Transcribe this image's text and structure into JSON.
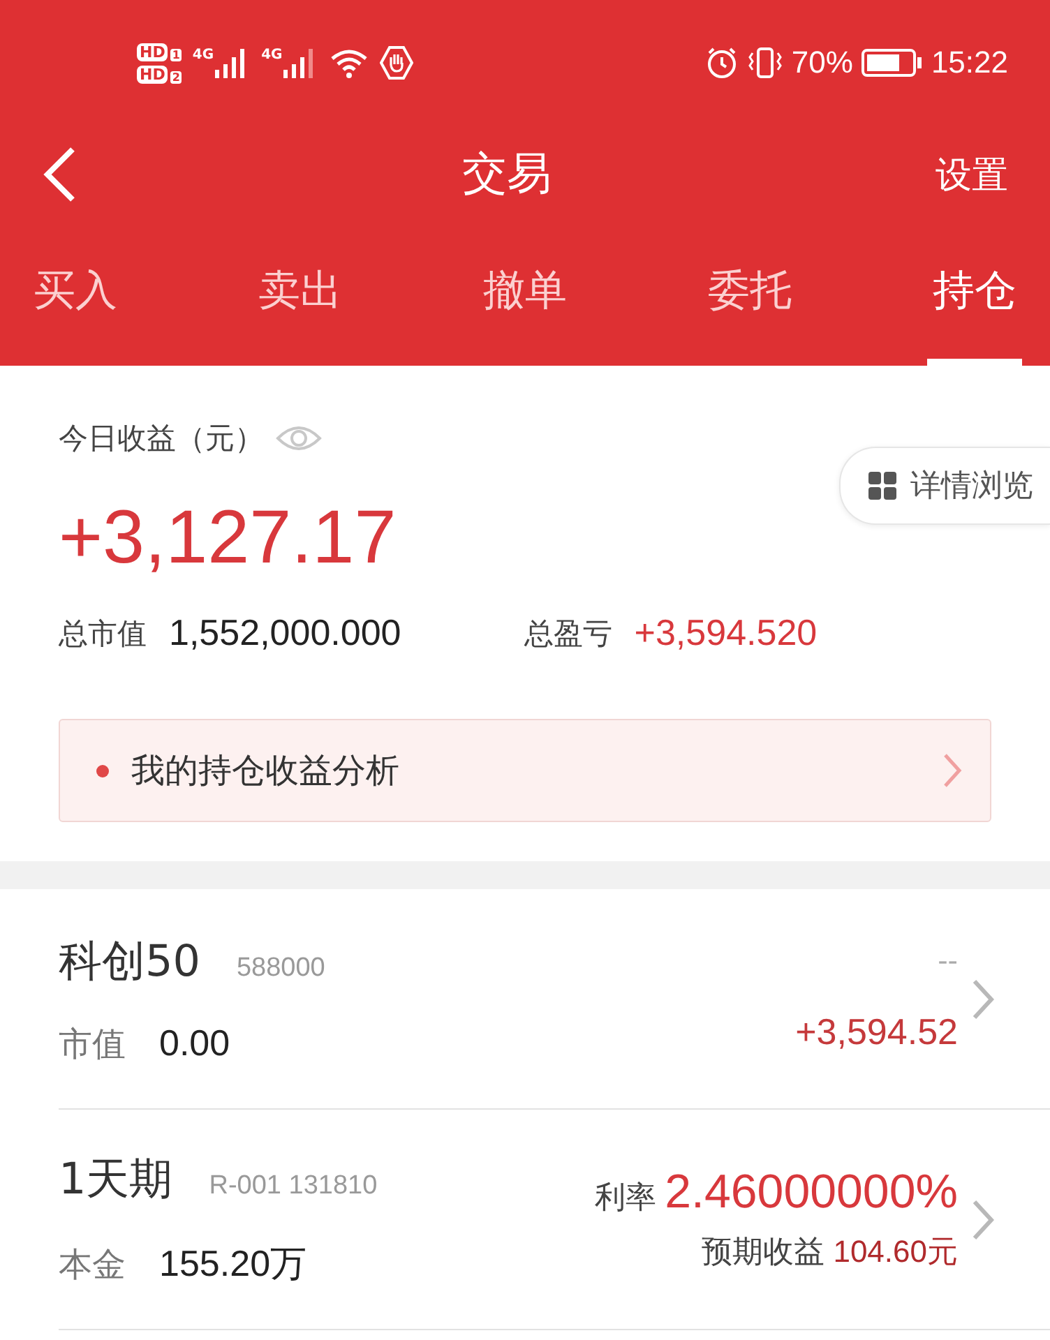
{
  "status_bar": {
    "sims": [
      {
        "hd": "HD",
        "slot": "1",
        "network": "4G"
      },
      {
        "hd": "HD",
        "slot": "2",
        "network": "4G"
      }
    ],
    "battery": "70%",
    "time": "15:22"
  },
  "header": {
    "title": "交易",
    "action": "设置"
  },
  "tabs": [
    {
      "label": "买入",
      "selected": false
    },
    {
      "label": "卖出",
      "selected": false
    },
    {
      "label": "撤单",
      "selected": false
    },
    {
      "label": "委托",
      "selected": false
    },
    {
      "label": "持仓",
      "selected": true
    }
  ],
  "summary": {
    "label": "今日收益（元）",
    "value": "+3,127.17",
    "detail_button": "详情浏览",
    "market_value_label": "总市值",
    "market_value": "1,552,000.000",
    "profit_label": "总盈亏",
    "profit": "+3,594.520"
  },
  "analysis_link": "我的持仓收益分析",
  "holdings": [
    {
      "kind": "stock",
      "name": "科创50",
      "code": "588000",
      "top_right": "--",
      "sub_label": "市值",
      "sub_value": "0.00",
      "bottom_right": "+3,594.52"
    },
    {
      "kind": "repo",
      "name": "1天期",
      "code": "R-001 131810",
      "rate_label": "利率",
      "rate": "2.46000000%",
      "sub_label": "本金",
      "sub_value": "155.20万",
      "expected_label": "预期收益",
      "expected_value": "104.60元"
    }
  ]
}
